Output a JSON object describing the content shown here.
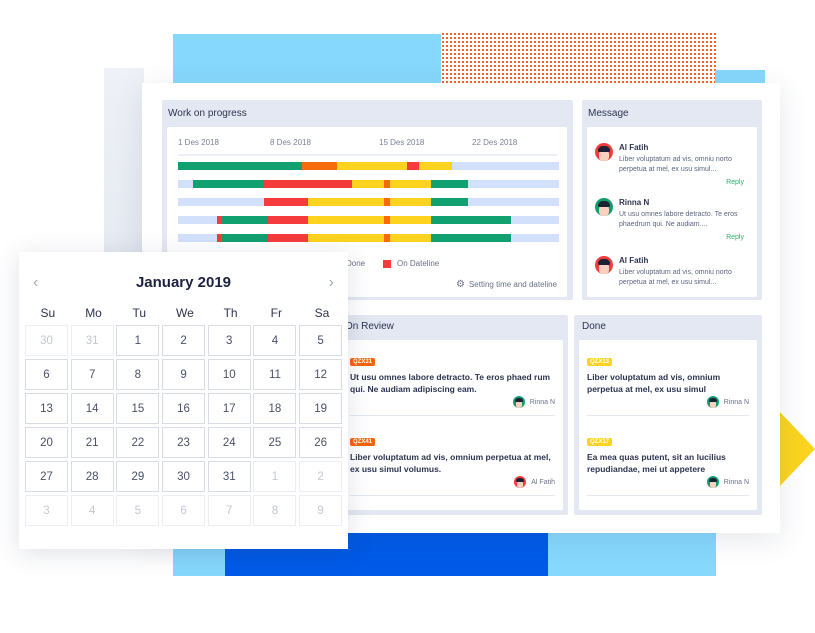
{
  "work_on_progress": {
    "title": "Work on progress",
    "dates": [
      "1 Des 2018",
      "8 Des 2018",
      "15 Des 2018",
      "22 Des 2018"
    ],
    "status_colors": {
      "done": "#11a06f",
      "warning": "#f66b0c",
      "in_progress": "#fdd320",
      "on_dateline": "#f53b3b",
      "remaining": "#d2e0fb"
    },
    "rows": [
      [
        {
          "s": "done",
          "from": 0,
          "to": 0.325
        },
        {
          "s": "warning",
          "from": 0.325,
          "to": 0.417
        },
        {
          "s": "in_progress",
          "from": 0.417,
          "to": 0.6
        },
        {
          "s": "on_dateline",
          "from": 0.6,
          "to": 0.633
        },
        {
          "s": "in_progress",
          "from": 0.633,
          "to": 0.72
        }
      ],
      [
        {
          "s": "done",
          "from": 0.04,
          "to": 0.225
        },
        {
          "s": "on_dateline",
          "from": 0.225,
          "to": 0.457
        },
        {
          "s": "in_progress",
          "from": 0.457,
          "to": 0.54
        },
        {
          "s": "warning",
          "from": 0.54,
          "to": 0.557
        },
        {
          "s": "in_progress",
          "from": 0.557,
          "to": 0.664
        },
        {
          "s": "done",
          "from": 0.664,
          "to": 0.762
        }
      ],
      [
        {
          "s": "on_dateline",
          "from": 0.225,
          "to": 0.342
        },
        {
          "s": "in_progress",
          "from": 0.342,
          "to": 0.54
        },
        {
          "s": "warning",
          "from": 0.54,
          "to": 0.557
        },
        {
          "s": "in_progress",
          "from": 0.557,
          "to": 0.664
        },
        {
          "s": "done",
          "from": 0.664,
          "to": 0.762
        }
      ],
      [
        {
          "s": "on_dateline",
          "from": 0.102,
          "to": 0.116
        },
        {
          "s": "done",
          "from": 0.116,
          "to": 0.235
        },
        {
          "s": "on_dateline",
          "from": 0.235,
          "to": 0.342
        },
        {
          "s": "in_progress",
          "from": 0.342,
          "to": 0.54
        },
        {
          "s": "warning",
          "from": 0.54,
          "to": 0.557
        },
        {
          "s": "in_progress",
          "from": 0.557,
          "to": 0.664
        },
        {
          "s": "done",
          "from": 0.664,
          "to": 0.875
        }
      ],
      [
        {
          "s": "on_dateline",
          "from": 0.102,
          "to": 0.116
        },
        {
          "s": "done",
          "from": 0.116,
          "to": 0.235
        },
        {
          "s": "on_dateline",
          "from": 0.235,
          "to": 0.342
        },
        {
          "s": "in_progress",
          "from": 0.342,
          "to": 0.54
        },
        {
          "s": "warning",
          "from": 0.54,
          "to": 0.557
        },
        {
          "s": "in_progress",
          "from": 0.557,
          "to": 0.664
        },
        {
          "s": "done",
          "from": 0.664,
          "to": 0.875
        }
      ]
    ],
    "legend": [
      {
        "label": "Done",
        "color": "#11a06f"
      },
      {
        "label": "On Dateline",
        "color": "#f53b3b"
      }
    ],
    "settings_label": "Setting time and dateline",
    "settings_icon": "gear-icon"
  },
  "messages": {
    "title": "Message",
    "items": [
      {
        "name": "Al Fatih",
        "text": "Liber voluptatum ad vis, omniu norto perpetua at mel, ex usu simul...",
        "reply": "Reply",
        "avatar_color": "red"
      },
      {
        "name": "Rinna N",
        "text": "Ut usu omnes labore detracto. Te eros phaedrum qui. Ne audiam....",
        "reply": "Reply",
        "avatar_color": "green"
      },
      {
        "name": "Al Fatih",
        "text": "Liber voluptatum ad vis, omniu norto perpetua at mel, ex usu simul...",
        "reply": "",
        "avatar_color": "red"
      }
    ]
  },
  "on_review": {
    "title": "On Review",
    "tasks": [
      {
        "id": "QZX31",
        "text": "Ut usu omnes labore detracto. Te eros phaed rum qui. Ne audiam adipiscing eam.",
        "assignee": "Rinna N",
        "avatar_color": "green"
      },
      {
        "id": "QZX41",
        "text": "Liber voluptatum ad vis, omnium perpetua at mel, ex usu simul volumus.",
        "assignee": "Al Fatih",
        "avatar_color": "red"
      }
    ]
  },
  "done": {
    "title": "Done",
    "tasks": [
      {
        "id": "QZX13",
        "text": "Liber voluptatum ad vis, omnium perpetua at mel, ex usu simul",
        "assignee": "Rinna N",
        "avatar_color": "green"
      },
      {
        "id": "QZX17",
        "text": "Ea mea quas putent, sit an lucilius repudiandae, mei ut appetere",
        "assignee": "Rinna N",
        "avatar_color": "green"
      }
    ]
  },
  "calendar": {
    "title": "January 2019",
    "prev_icon": "chevron-left-icon",
    "next_icon": "chevron-right-icon",
    "prev_glyph": "‹",
    "next_glyph": "›",
    "weekdays": [
      "Su",
      "Mo",
      "Tu",
      "We",
      "Th",
      "Fr",
      "Sa"
    ],
    "days": [
      {
        "d": "30",
        "m": true
      },
      {
        "d": "31",
        "m": true
      },
      {
        "d": "1"
      },
      {
        "d": "2"
      },
      {
        "d": "3"
      },
      {
        "d": "4"
      },
      {
        "d": "5"
      },
      {
        "d": "6"
      },
      {
        "d": "7"
      },
      {
        "d": "8"
      },
      {
        "d": "9"
      },
      {
        "d": "10"
      },
      {
        "d": "11"
      },
      {
        "d": "12"
      },
      {
        "d": "13"
      },
      {
        "d": "14"
      },
      {
        "d": "15"
      },
      {
        "d": "16"
      },
      {
        "d": "17"
      },
      {
        "d": "18"
      },
      {
        "d": "19"
      },
      {
        "d": "20"
      },
      {
        "d": "21"
      },
      {
        "d": "22"
      },
      {
        "d": "23"
      },
      {
        "d": "24"
      },
      {
        "d": "25"
      },
      {
        "d": "26"
      },
      {
        "d": "27"
      },
      {
        "d": "28"
      },
      {
        "d": "29"
      },
      {
        "d": "30"
      },
      {
        "d": "31"
      },
      {
        "d": "1",
        "m": true
      },
      {
        "d": "2",
        "m": true
      },
      {
        "d": "3",
        "m": true
      },
      {
        "d": "4",
        "m": true
      },
      {
        "d": "5",
        "m": true
      },
      {
        "d": "6",
        "m": true
      },
      {
        "d": "7",
        "m": true
      },
      {
        "d": "8",
        "m": true
      },
      {
        "d": "9",
        "m": true
      }
    ]
  },
  "decor_colors": {
    "light_blue": "#87d8fd",
    "dark_blue": "#015be8",
    "dots_orange": "#f05a1a",
    "yellow": "#fcd41f"
  }
}
